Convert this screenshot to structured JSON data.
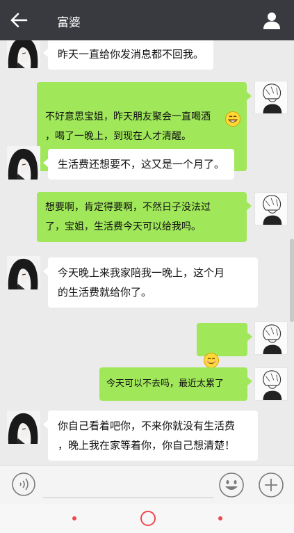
{
  "header": {
    "title": "富婆"
  },
  "messages": [
    {
      "side": "in",
      "text": "昨天一直给你发消息都不回我。"
    },
    {
      "side": "out",
      "text": "不好意思宝姐，昨天朋友聚会一直喝酒\n，喝了一晚上，到现在人才清醒。"
    },
    {
      "side": "in",
      "text": "生活费还想要不，这又是一个月了。"
    },
    {
      "side": "out",
      "text": "想要啊，肯定得要啊，不然日子没法过\n了，宝姐，生活费今天可以给我吗。"
    },
    {
      "side": "in",
      "text": "今天晚上来我家陪我一晚上，这个月\n的生活费就给你了。"
    },
    {
      "side": "out",
      "text": ""
    },
    {
      "side": "out",
      "text": "今天可以不去吗，最近太累了"
    },
    {
      "side": "in",
      "text": "你自己看着吧你，不来你就没有生活费\n，晚上我在家等着你，你自己想清楚！"
    }
  ],
  "icons": {
    "back": "arrow-left-icon",
    "profile": "person-icon",
    "voice": "voice-icon",
    "emoji": "smiley-icon",
    "plus": "plus-icon",
    "grin": "grin-emoji",
    "smile": "smile-emoji",
    "blush": "blush-emoji"
  },
  "colors": {
    "topbar": "#393a3f",
    "outgoing_bubble": "#a0e75a",
    "incoming_bubble": "#ffffff",
    "background": "#ebebeb",
    "nav_accent": "#f0474f"
  },
  "input": {
    "value": "",
    "placeholder": ""
  }
}
